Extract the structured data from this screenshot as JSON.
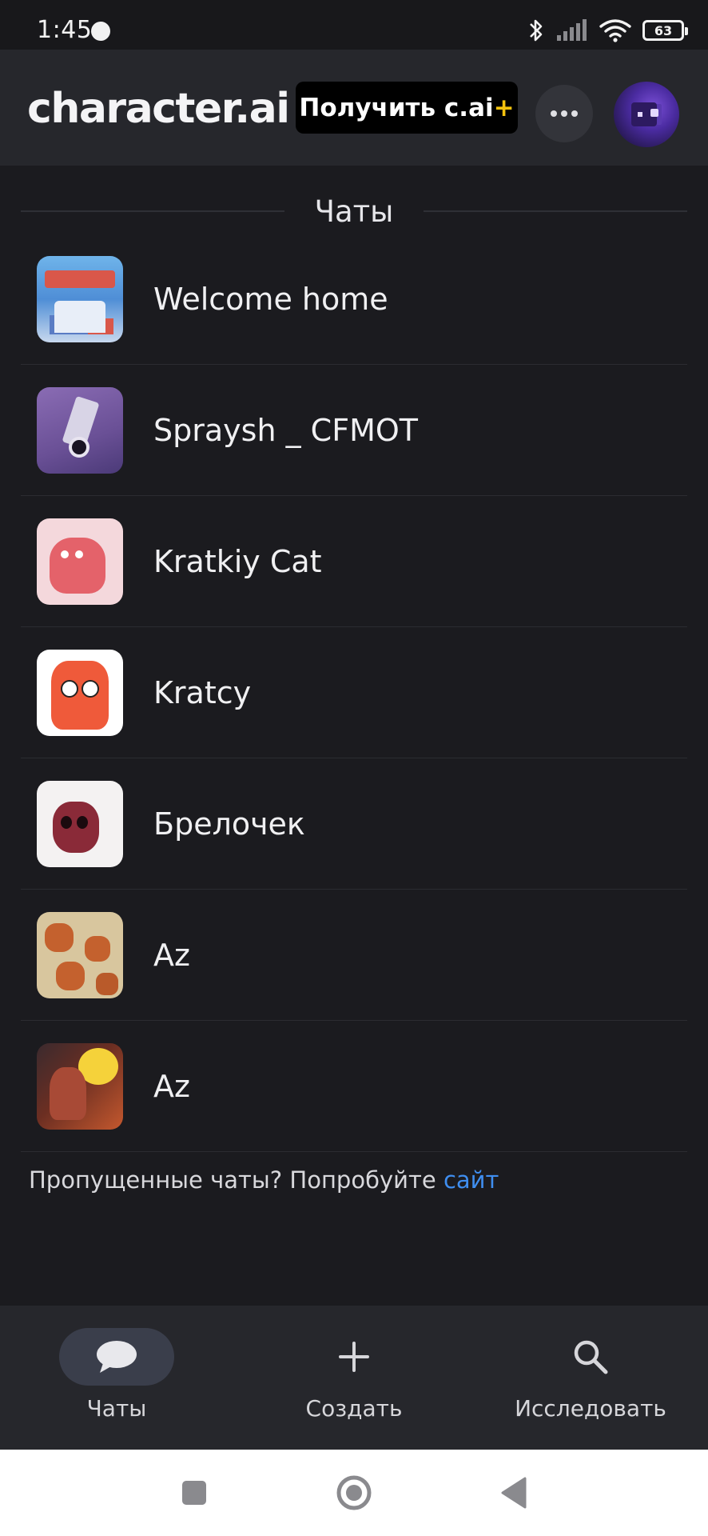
{
  "status_bar": {
    "time": "1:45",
    "battery": "63"
  },
  "header": {
    "logo": "character.ai",
    "upgrade_label": "Получить c.ai",
    "upgrade_plus": "+",
    "more_icon": "more-horizontal-icon",
    "avatar_icon": "profile-avatar"
  },
  "section": {
    "title": "Чаты"
  },
  "chats": [
    {
      "name": "Welcome home"
    },
    {
      "name": "Spraysh _ CFMOT"
    },
    {
      "name": "Kratkiy Cat"
    },
    {
      "name": "Kratcy"
    },
    {
      "name": "Брелочек"
    },
    {
      "name": "Az"
    },
    {
      "name": "Az"
    }
  ],
  "missed": {
    "text": "Пропущенные чаты? Попробуйте ",
    "link": "сайт"
  },
  "bottom_nav": {
    "chats": "Чаты",
    "create": "Создать",
    "explore": "Исследовать"
  },
  "colors": {
    "background": "#1b1b1f",
    "header": "#26272c",
    "accent_plus": "#f4c20d",
    "link": "#3f8ef0"
  }
}
